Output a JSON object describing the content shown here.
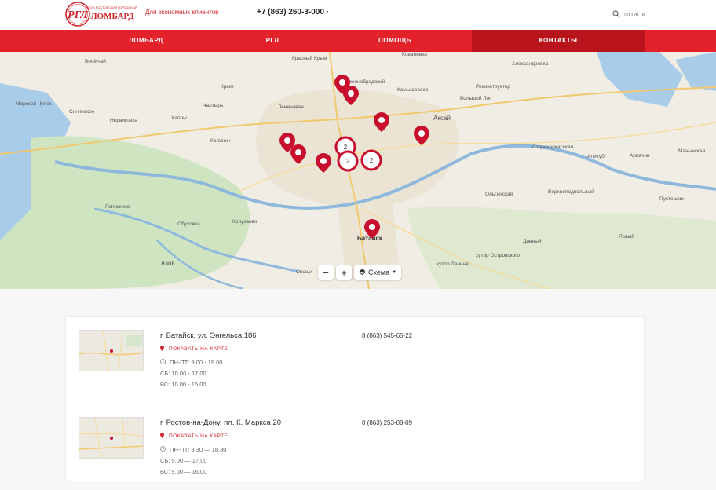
{
  "header": {
    "logo_text": "РГЛ",
    "logo_subtitle": "ООО РОСТОВСКИЙ ГОРОДСКОЙ",
    "logo_word": "ЛОМБАРД",
    "tagline": "Для экономных клиентов",
    "phone": "+7 (863) 260-3-000 ·",
    "search_label": "поиск"
  },
  "nav": {
    "items": [
      {
        "label": "ЛОМБАРД"
      },
      {
        "label": "РГЛ"
      },
      {
        "label": "ПОМОЩЬ"
      },
      {
        "label": "КОНТАКТЫ"
      }
    ]
  },
  "map": {
    "place_labels": [
      "Весёлый",
      "Красный Крым",
      "Ковалевка",
      "Александровка",
      "Крым",
      "Каменнобродский",
      "Реконструктор",
      "Морской Чулек",
      "Чалтырь",
      "Камышеваха",
      "Большой Лог",
      "Синявское",
      "Недвиговка",
      "Хапры",
      "Ленинаван",
      "Аксай",
      "Калинин",
      "Старочеркасская",
      "Алитуб",
      "Арпачин",
      "Манычская",
      "Рогожкино",
      "Ольгинская",
      "Верхнеподпольный",
      "Пустошкин",
      "Обуховка",
      "Колузаево",
      "Азов",
      "Батайск",
      "Дивный",
      "Ясный",
      "Овощи",
      "хутор Островского",
      "хутор Ленина"
    ],
    "clusters": [
      "2",
      "2"
    ],
    "zoom_in": "+",
    "zoom_out": "−",
    "layer_label": "Схема"
  },
  "offices": [
    {
      "address": "г. Батайск, ул. Энгельса 186",
      "show_map": "ПОКАЗАТЬ НА КАРТЕ",
      "hours_weekday": "ПН-ПТ: 9.00 - 19.00",
      "hours_sat": "СБ: 10.00 - 17.00",
      "hours_sun": "ВС: 10.00 - 15.00",
      "phone": "8 (863) 545-65-22"
    },
    {
      "address": "г. Ростов-на-Дону, пл. К. Маркса 20",
      "show_map": "ПОКАЗАТЬ НА КАРТЕ",
      "hours_weekday": "ПН-ПТ: 8.30 — 18.30",
      "hours_sat": "СБ: 9.00 — 17.00",
      "hours_sun": "ВС: 9.00 — 16.00",
      "phone": "8 (863) 253-08-09"
    }
  ],
  "colors": {
    "brand_red": "#e3212b",
    "nav_active": "#b9141c",
    "marker": "#c8102e"
  }
}
